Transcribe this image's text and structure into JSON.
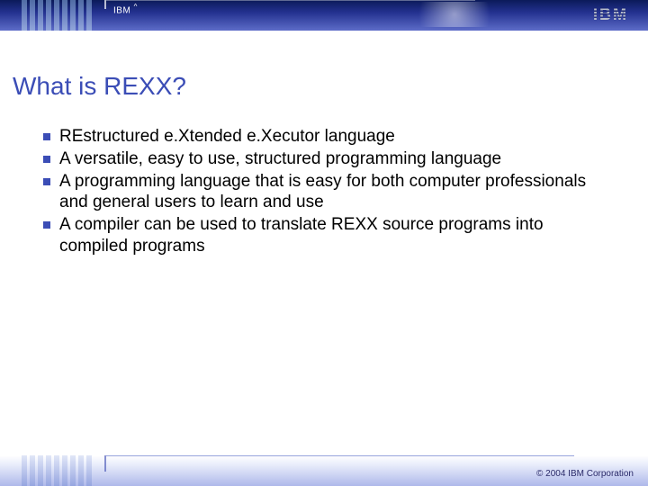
{
  "header": {
    "brand_short": "IBM",
    "caret": "^",
    "logo_text": "IBM"
  },
  "title": "What is REXX?",
  "bullets": [
    "REstructured e.Xtended e.Xecutor language",
    "A versatile, easy to use, structured programming language",
    "A programming language that is easy for both computer professionals and general users to learn and use",
    "A compiler can be used to translate REXX source programs into compiled programs"
  ],
  "footer": {
    "copyright": "© 2004 IBM Corporation"
  }
}
